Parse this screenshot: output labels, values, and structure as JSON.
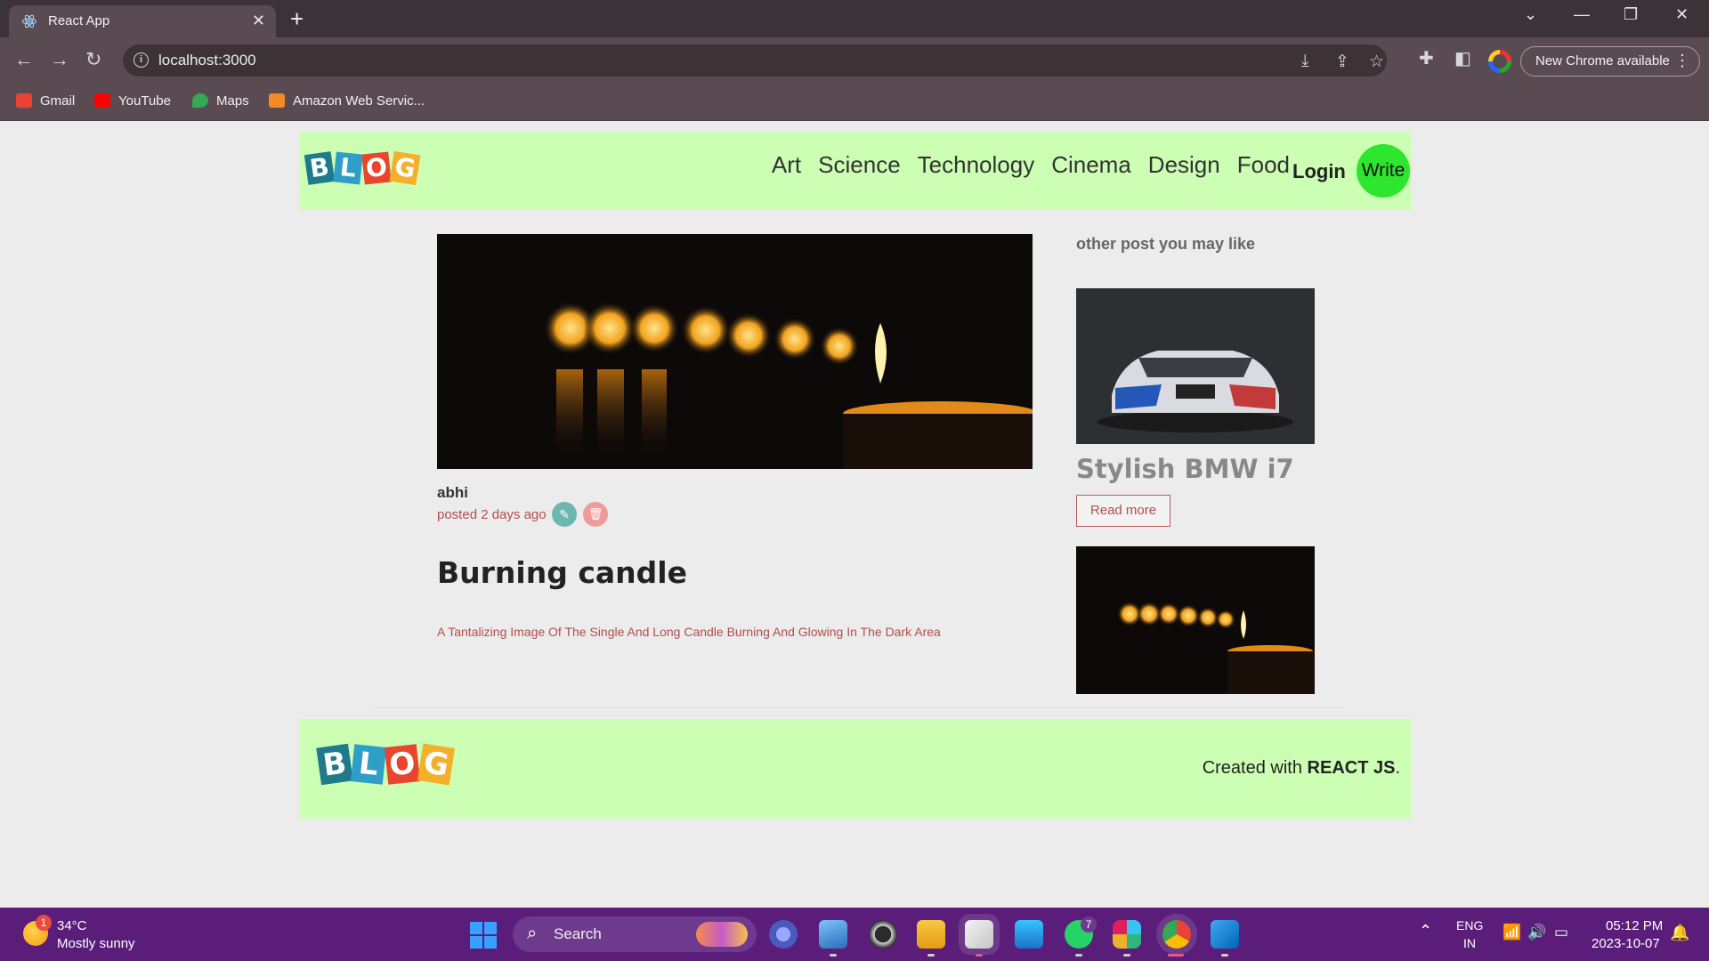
{
  "browser": {
    "tab_title": "React App",
    "tab_close": "✕",
    "new_tab": "+",
    "url": "localhost:3000",
    "update_label": "New Chrome available",
    "bookmarks": [
      {
        "label": "Gmail",
        "icon": "gmail-icon",
        "color": "#ea4335"
      },
      {
        "label": "YouTube",
        "icon": "youtube-icon",
        "color": "#ff0000"
      },
      {
        "label": "Maps",
        "icon": "maps-icon",
        "color": "#34a853"
      },
      {
        "label": "Amazon Web Servic...",
        "icon": "aws-icon",
        "color": "#f28b22"
      }
    ]
  },
  "header": {
    "logo_letters": [
      "B",
      "L",
      "O",
      "G"
    ],
    "nav": [
      "Art",
      "Science",
      "Technology",
      "Cinema",
      "Design",
      "Food"
    ],
    "login": "Login",
    "write": "Write"
  },
  "post": {
    "author": "abhi",
    "posted": "posted 2 days ago",
    "title": "Burning candle",
    "description": "A Tantalizing Image Of The Single And Long Candle Burning And Glowing In The Dark Area"
  },
  "sidebar": {
    "heading": "other post you may like",
    "cards": [
      {
        "title": "Stylish BMW i7",
        "button": "Read more"
      }
    ]
  },
  "footer": {
    "prefix": "Created with ",
    "tech": "REACT JS",
    "suffix": "."
  },
  "taskbar": {
    "weather_badge": "1",
    "temperature": "34°C",
    "weather": "Mostly sunny",
    "search": "Search",
    "lang_top": "ENG",
    "lang_bottom": "IN",
    "time": "05:12 PM",
    "date": "2023-10-07",
    "whatsapp_badge": "7"
  },
  "colors": {
    "header_bg": "#ccffb3",
    "write_button": "#2ee62e",
    "accent_text": "#b24d4d",
    "taskbar_bg": "#5a1e7a"
  }
}
